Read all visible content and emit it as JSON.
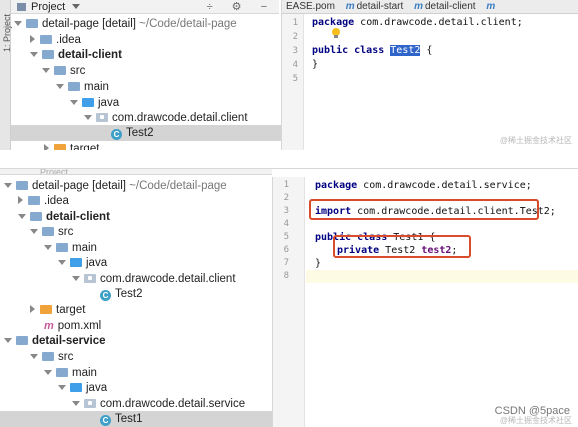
{
  "top_panel": {
    "side_label": "1: Project",
    "header_label": "Project",
    "header_icons": "÷ ⚙ −",
    "tree": [
      {
        "text": "detail-page [detail]",
        "suffix": " ~/Code/detail-page"
      },
      {
        "text": ".idea"
      },
      {
        "text": "detail-client"
      },
      {
        "text": "src"
      },
      {
        "text": "main"
      },
      {
        "text": "java"
      },
      {
        "text": "com.drawcode.detail.client"
      },
      {
        "text": "Test2"
      },
      {
        "text": "target"
      }
    ],
    "tabs": [
      {
        "label": "EASE.pom"
      },
      {
        "label": "detail-start"
      },
      {
        "label": "detail-client"
      }
    ],
    "code": {
      "line1_kw": "package",
      "line1_rest": " com.drawcode.detail.client;",
      "line3_kw": "public class",
      "line3_sel": "Test2",
      "line3_rest": " {",
      "line4": "}"
    },
    "line_numbers": [
      "1",
      "2",
      "3",
      "4",
      "5"
    ],
    "watermark": "@稀土掘金技术社区"
  },
  "bottom_panel": {
    "header_faint": "Project",
    "tree": [
      {
        "text": "detail-page [detail]",
        "suffix": " ~/Code/detail-page"
      },
      {
        "text": ".idea"
      },
      {
        "text": "detail-client"
      },
      {
        "text": "src"
      },
      {
        "text": "main"
      },
      {
        "text": "java"
      },
      {
        "text": "com.drawcode.detail.client"
      },
      {
        "text": "Test2"
      },
      {
        "text": "target"
      },
      {
        "text": "pom.xml"
      },
      {
        "text": "detail-service"
      },
      {
        "text": "src"
      },
      {
        "text": "main"
      },
      {
        "text": "java"
      },
      {
        "text": "com.drawcode.detail.service"
      },
      {
        "text": "Test1"
      }
    ],
    "line_numbers": [
      "1",
      "2",
      "3",
      "4",
      "5",
      "6",
      "7",
      "8"
    ],
    "code": {
      "l1_kw": "package",
      "l1_rest": " com.drawcode.detail.service;",
      "l3_kw": "import",
      "l3_rest": " com.drawcode.detail.client.Test2;",
      "l5_kw": "public class",
      "l5_rest": " Test1 {",
      "l6_kw": "private",
      "l6_type": " Test2 ",
      "l6_field": "test2",
      "l6_end": ";",
      "l7": "}"
    },
    "watermark": "@稀土掘金技术社区",
    "csdn": "CSDN @5pace"
  }
}
